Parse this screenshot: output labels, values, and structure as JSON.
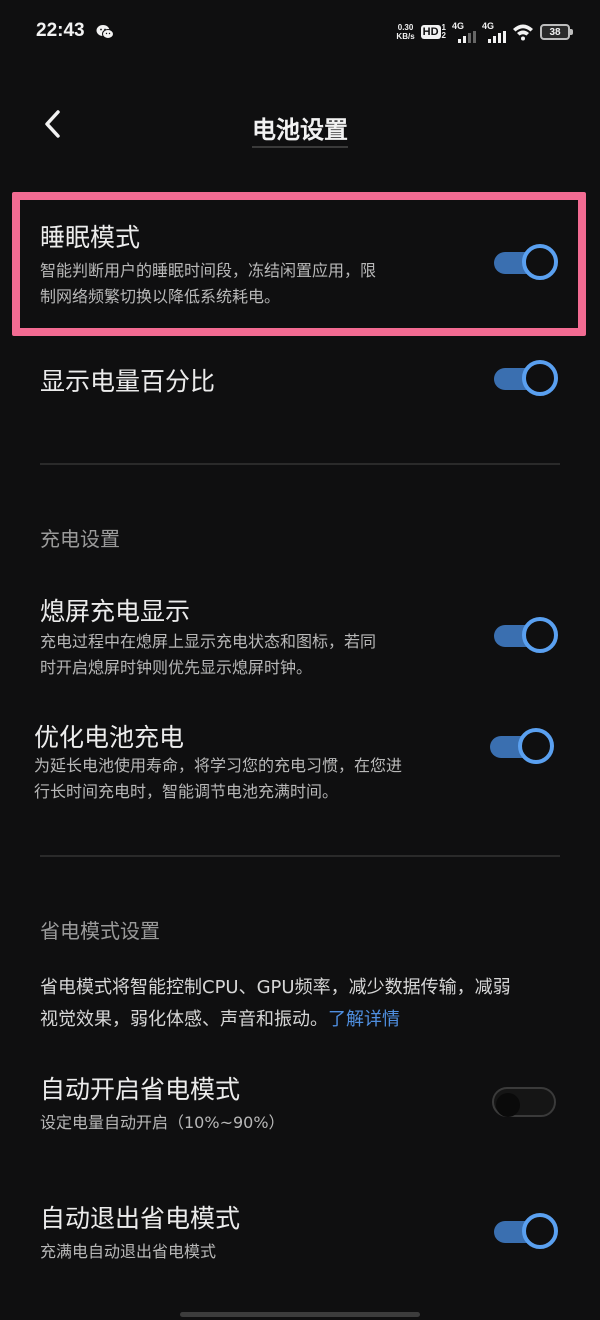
{
  "status_bar": {
    "time": "22:43",
    "net_speed_value": "0.30",
    "net_speed_unit": "KB/s",
    "hd_label": "HD",
    "hd_sim1": "1",
    "hd_sim2": "2",
    "signal1_label": "4G",
    "signal2_label": "4G",
    "battery_level": "38"
  },
  "header": {
    "title": "电池设置",
    "back_icon": "chevron-left-icon"
  },
  "settings": {
    "sleep_mode": {
      "title": "睡眠模式",
      "desc_line1": "智能判断用户的睡眠时间段，冻结闲置应用，限",
      "desc_line2": "制网络频繁切换以降低系统耗电。",
      "enabled": true
    },
    "battery_percent": {
      "title": "显示电量百分比",
      "enabled": true
    },
    "charging_section": {
      "header": "充电设置"
    },
    "screen_off_charge": {
      "title": "熄屏充电显示",
      "desc_line1": "充电过程中在熄屏上显示充电状态和图标，若同",
      "desc_line2": "时开启熄屏时钟则优先显示熄屏时钟。",
      "enabled": true
    },
    "optimized_charge": {
      "title": "优化电池充电",
      "desc_line1": "为延长电池使用寿命，将学习您的充电习惯，在您进",
      "desc_line2": "行长时间充电时，智能调节电池充满时间。",
      "enabled": true
    },
    "power_saving_section": {
      "header": "省电模式设置",
      "info_line1": "省电模式将智能控制CPU、GPU频率，减少数据传输，减弱",
      "info_line2": "视觉效果，弱化体感、声音和振动。",
      "info_link": "了解详情"
    },
    "auto_enable_saving": {
      "title": "自动开启省电模式",
      "desc": "设定电量自动开启（10%~90%）",
      "enabled": false
    },
    "auto_exit_saving": {
      "title": "自动退出省电模式",
      "desc": "充满电自动退出省电模式",
      "enabled": true
    }
  },
  "colors": {
    "background": "#0f0f10",
    "accent_blue": "#5aa0f0",
    "track_blue": "#3a6fb0",
    "highlight_pink": "#f26b92",
    "link_blue": "#4f8fe0"
  }
}
